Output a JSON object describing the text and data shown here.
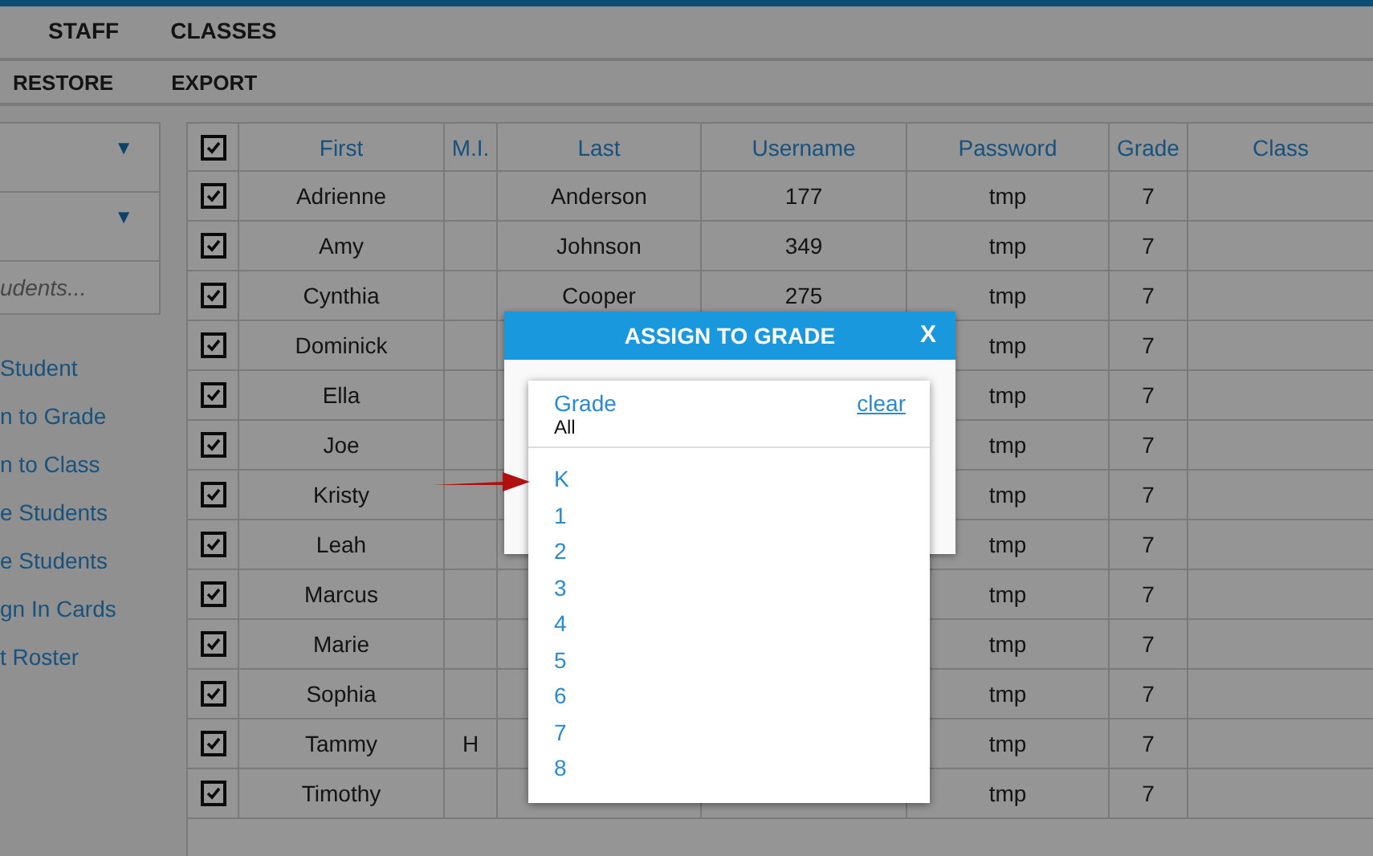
{
  "tabs": [
    {
      "label": "STAFF",
      "selected": false
    },
    {
      "label": "CLASSES",
      "selected": false
    }
  ],
  "toolbar": [
    "RESTORE",
    "EXPORT"
  ],
  "sidebar": {
    "filters": [
      {
        "arrow": "▼"
      },
      {
        "arrow": "▼"
      }
    ],
    "search": {
      "placeholder": "udents..."
    },
    "links": [
      "Student",
      "n to Grade",
      "n to Class",
      "e Students",
      "e Students",
      "gn In Cards",
      "t Roster"
    ]
  },
  "table": {
    "all_checked": true,
    "columns": [
      "First",
      "M.I.",
      "Last",
      "Username",
      "Password",
      "Grade",
      "Class"
    ],
    "rows": [
      {
        "checked": true,
        "first": "Adrienne",
        "last": "Anderson",
        "username": "177",
        "password": "tmp",
        "grade": "7"
      },
      {
        "checked": true,
        "first": "Amy",
        "last": "Johnson",
        "username": "349",
        "password": "tmp",
        "grade": "7"
      },
      {
        "checked": true,
        "first": "Cynthia",
        "last": "Cooper",
        "username": "275",
        "password": "tmp",
        "grade": "7"
      },
      {
        "checked": true,
        "first": "Dominick",
        "password": "tmp",
        "grade": "7"
      },
      {
        "checked": true,
        "first": "Ella",
        "password": "tmp",
        "grade": "7"
      },
      {
        "checked": true,
        "first": "Joe",
        "password": "tmp",
        "grade": "7"
      },
      {
        "checked": true,
        "first": "Kristy",
        "password": "tmp",
        "grade": "7"
      },
      {
        "checked": true,
        "first": "Leah",
        "password": "tmp",
        "grade": "7"
      },
      {
        "checked": true,
        "first": "Marcus",
        "password": "tmp",
        "grade": "7"
      },
      {
        "checked": true,
        "first": "Marie",
        "password": "tmp",
        "grade": "7"
      },
      {
        "checked": true,
        "first": "Sophia",
        "password": "tmp",
        "grade": "7"
      },
      {
        "checked": true,
        "first": "Tammy",
        "mi": "H",
        "password": "tmp",
        "grade": "7"
      },
      {
        "checked": true,
        "first": "Timothy",
        "password": "tmp",
        "grade": "7"
      }
    ]
  },
  "dialog": {
    "title": "ASSIGN TO GRADE",
    "close": "X",
    "dropdown": {
      "label": "Grade",
      "value": "All",
      "clear": "clear",
      "options": [
        {
          "label": "K",
          "selected": false
        },
        {
          "label": "1",
          "selected": false
        },
        {
          "label": "2",
          "selected": false
        },
        {
          "label": "3",
          "selected": false
        },
        {
          "label": "4",
          "selected": false
        },
        {
          "label": "5",
          "selected": false
        },
        {
          "label": "6",
          "selected": false
        },
        {
          "label": "7",
          "selected": false
        },
        {
          "label": "8",
          "selected": false
        }
      ]
    }
  }
}
